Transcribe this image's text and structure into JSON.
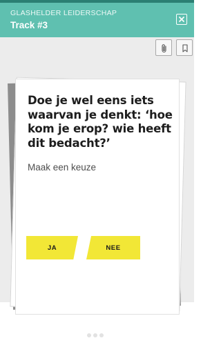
{
  "header": {
    "subtitle": "GLASHELDER LEIDERSCHAP",
    "title": "Track #3"
  },
  "toolbar": {
    "attachment_icon": "paperclip-icon",
    "bookmark_icon": "bookmark-icon"
  },
  "card": {
    "question": "Doe je wel eens iets waarvan je denkt: ‘hoe kom je erop? wie heeft dit bedacht?’",
    "prompt": "Maak een keuze",
    "choices": [
      {
        "label": "JA"
      },
      {
        "label": "NEE"
      }
    ]
  },
  "pager": {
    "pages": 3
  },
  "colors": {
    "header": "#5fc0b0",
    "status_bar": "#2b7f73",
    "choice_button": "#f2e736",
    "content_background": "#ececec"
  }
}
